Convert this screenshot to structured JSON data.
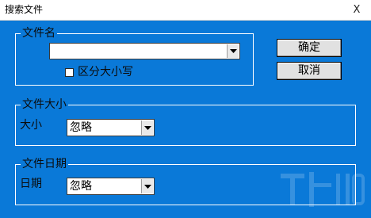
{
  "window": {
    "title": "搜索文件",
    "close_label": "X"
  },
  "file_name": {
    "group_label": "文件名",
    "value": "",
    "checkbox_label": "区分大小写",
    "checkbox_checked": false
  },
  "buttons": {
    "ok_label": "确定",
    "cancel_label": "取消"
  },
  "file_size": {
    "group_label": "文件大小",
    "field_label": "大小",
    "selected": "忽略"
  },
  "file_date": {
    "group_label": "文件日期",
    "field_label": "日期",
    "selected": "忽略"
  },
  "colors": {
    "background": "#0a79d8",
    "titlebar": "#ffffff"
  }
}
